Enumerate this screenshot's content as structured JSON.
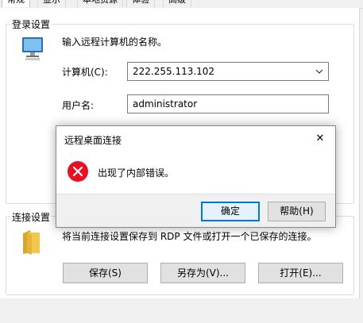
{
  "tabs": [
    {
      "label": "常规"
    },
    {
      "label": "显示"
    },
    {
      "label": "本地资源"
    },
    {
      "label": "体验"
    },
    {
      "label": "高级"
    }
  ],
  "login_settings": {
    "group_title": "登录设置",
    "prompt": "输入远程计算机的名称。",
    "computer_label": "计算机(C):",
    "computer_value": "222.255.113.102",
    "user_label": "用户名:",
    "user_value": "administrator"
  },
  "connection_settings": {
    "group_title": "连接设置",
    "description": "将当前连接设置保存到 RDP 文件或打开一个已保存的连接。",
    "save_label": "保存(S)",
    "save_as_label": "另存为(V)...",
    "open_label": "打开(E)..."
  },
  "dialog": {
    "title": "远程桌面连接",
    "message": "出现了内部错误。",
    "ok_label": "确定",
    "help_label": "帮助(H)",
    "close_glyph": "✕"
  },
  "icons": {
    "computer": "computer-icon",
    "folder": "folder-icon",
    "error": "error-icon",
    "dropdown": "chevron-down-icon"
  },
  "colors": {
    "accent": "#0078d7",
    "error_red": "#e81123",
    "folder_yellow": "#f0c94c"
  }
}
